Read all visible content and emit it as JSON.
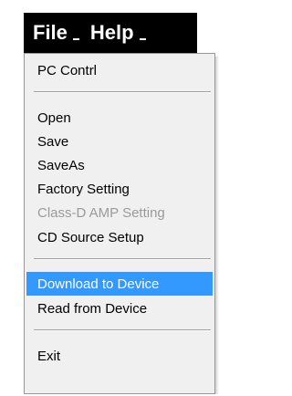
{
  "menubar": {
    "items": [
      {
        "label": "File"
      },
      {
        "label": "Help"
      }
    ]
  },
  "file_menu": {
    "items": [
      {
        "label": "PC Contrl",
        "enabled": true
      },
      {
        "label": "Open",
        "enabled": true
      },
      {
        "label": "Save",
        "enabled": true
      },
      {
        "label": "SaveAs",
        "enabled": true
      },
      {
        "label": "Factory Setting",
        "enabled": true
      },
      {
        "label": "Class-D AMP Setting",
        "enabled": false
      },
      {
        "label": "CD Source Setup",
        "enabled": true
      },
      {
        "label": "Download to Device",
        "enabled": true,
        "highlighted": true
      },
      {
        "label": "Read from Device",
        "enabled": true
      },
      {
        "label": "Exit",
        "enabled": true
      }
    ]
  },
  "colors": {
    "menubar_bg": "#000000",
    "menu_bg": "#f0f0f0",
    "highlight": "#3399ff",
    "disabled_text": "#9a9a9a"
  }
}
